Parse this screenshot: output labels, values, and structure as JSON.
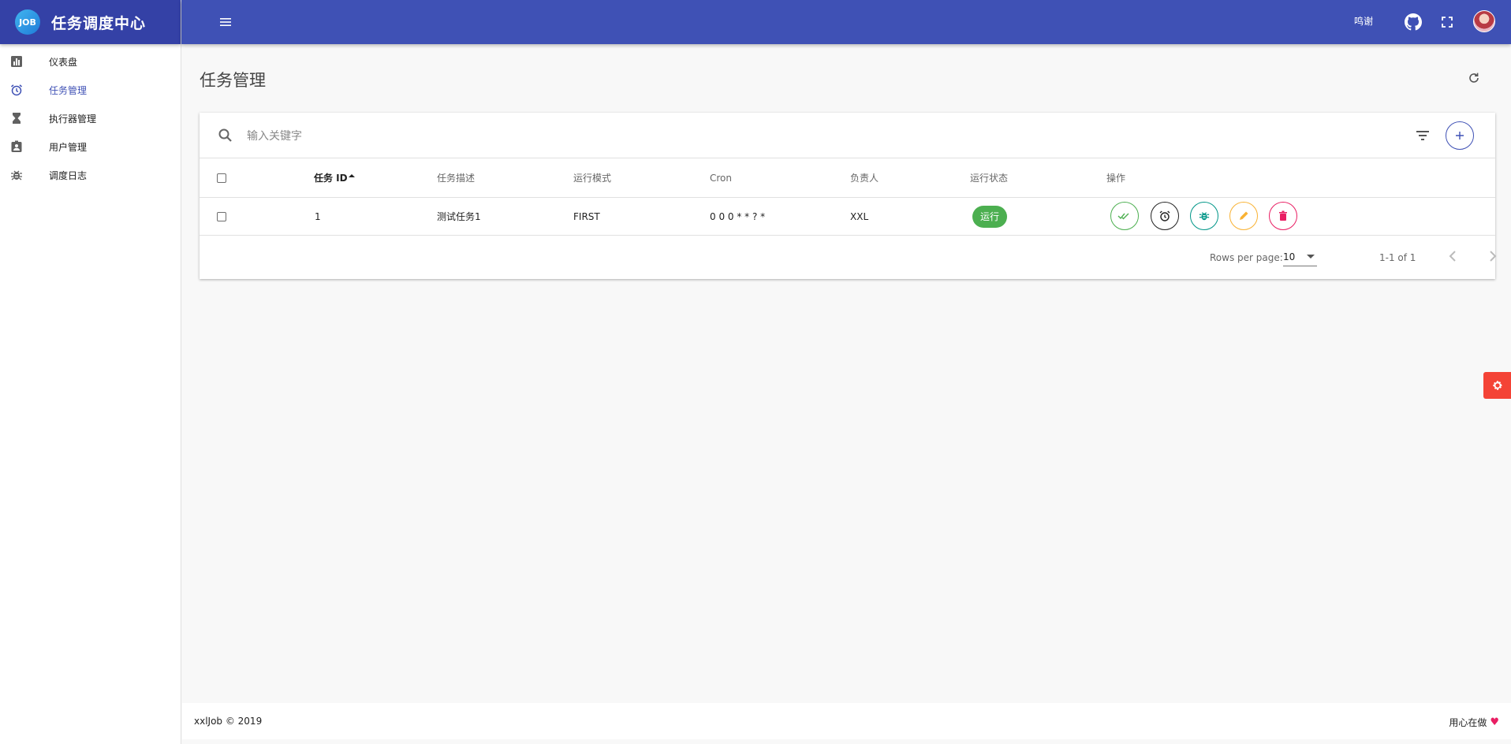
{
  "app": {
    "logo": "JOB",
    "title": "任务调度中心"
  },
  "sidebar": {
    "items": [
      {
        "label": "仪表盘",
        "icon": "bar-chart-icon"
      },
      {
        "label": "任务管理",
        "icon": "alarm-clock-icon",
        "active": true
      },
      {
        "label": "执行器管理",
        "icon": "hourglass-icon"
      },
      {
        "label": "用户管理",
        "icon": "contact-card-icon"
      },
      {
        "label": "调度日志",
        "icon": "bug-icon"
      }
    ]
  },
  "topbar": {
    "user": "鸣谢"
  },
  "page": {
    "title": "任务管理"
  },
  "search": {
    "placeholder": "输入关键字",
    "value": ""
  },
  "table": {
    "headers": [
      "任务 ID",
      "任务描述",
      "运行模式",
      "Cron",
      "负责人",
      "运行状态",
      "操作"
    ],
    "sort_column": "任务 ID",
    "rows": [
      {
        "id": "1",
        "desc": "测试任务1",
        "mode": "FIRST",
        "cron": "0 0 0 * * ? *",
        "owner": "XXL",
        "status": "运行"
      }
    ]
  },
  "pagination": {
    "rows_per_page_label": "Rows per page:",
    "rows_per_page": "10",
    "range": "1-1 of 1"
  },
  "footer": {
    "left": "xxlJob © 2019",
    "right": "用心在做",
    "heart": "♥"
  },
  "colors": {
    "primary": "#3f51b5",
    "brand_dark": "#3441a6",
    "success": "#4caf50",
    "fab": "#f44336"
  }
}
